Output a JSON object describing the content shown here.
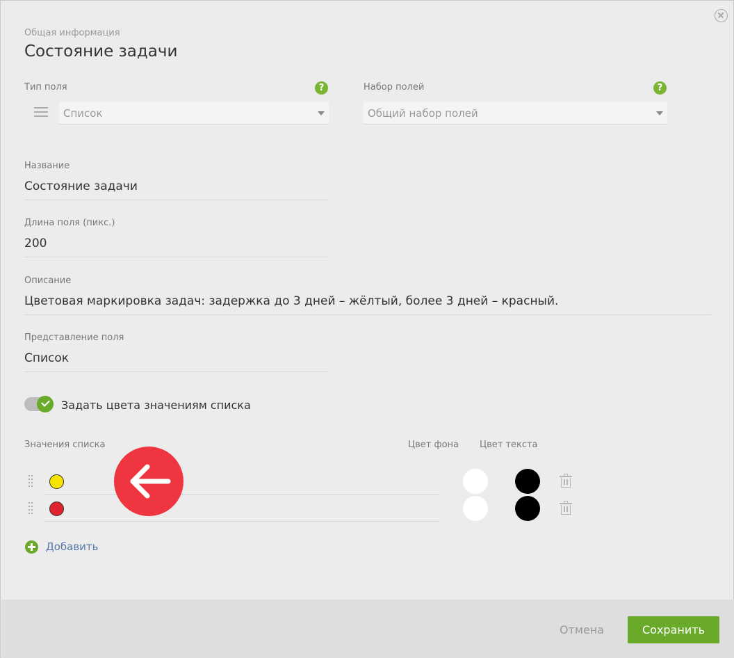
{
  "header": {
    "subtitle": "Общая информация",
    "title": "Состояние задачи"
  },
  "field_type": {
    "label": "Тип поля",
    "value": "Список",
    "icon": "list-icon"
  },
  "field_set": {
    "label": "Набор полей",
    "placeholder": "Общий набор полей"
  },
  "help_glyph": "?",
  "name": {
    "label": "Название",
    "value": "Состояние задачи"
  },
  "length": {
    "label": "Длина поля (пикс.)",
    "value": "200"
  },
  "description": {
    "label": "Описание",
    "value": "Цветовая маркировка задач: задержка до 3 дней – жёлтый, более 3 дней – красный."
  },
  "presentation": {
    "label": "Представление поля",
    "value": "Список"
  },
  "toggle": {
    "label": "Задать цвета значениям списка",
    "checked": true
  },
  "list": {
    "label": "Значения списка",
    "bg_color_label": "Цвет фона",
    "text_color_label": "Цвет текста",
    "items": [
      {
        "swatch": "#f5e400",
        "bg": "#ffffff",
        "text": "#000000"
      },
      {
        "swatch": "#e0242f",
        "bg": "#ffffff",
        "text": "#000000"
      }
    ]
  },
  "add_label": "Добавить",
  "footer": {
    "cancel_label": "Отмена",
    "save_label": "Сохранить"
  },
  "colors": {
    "accent": "#6aaa2a",
    "annotation": "#ee3540",
    "link": "#5577aa"
  }
}
